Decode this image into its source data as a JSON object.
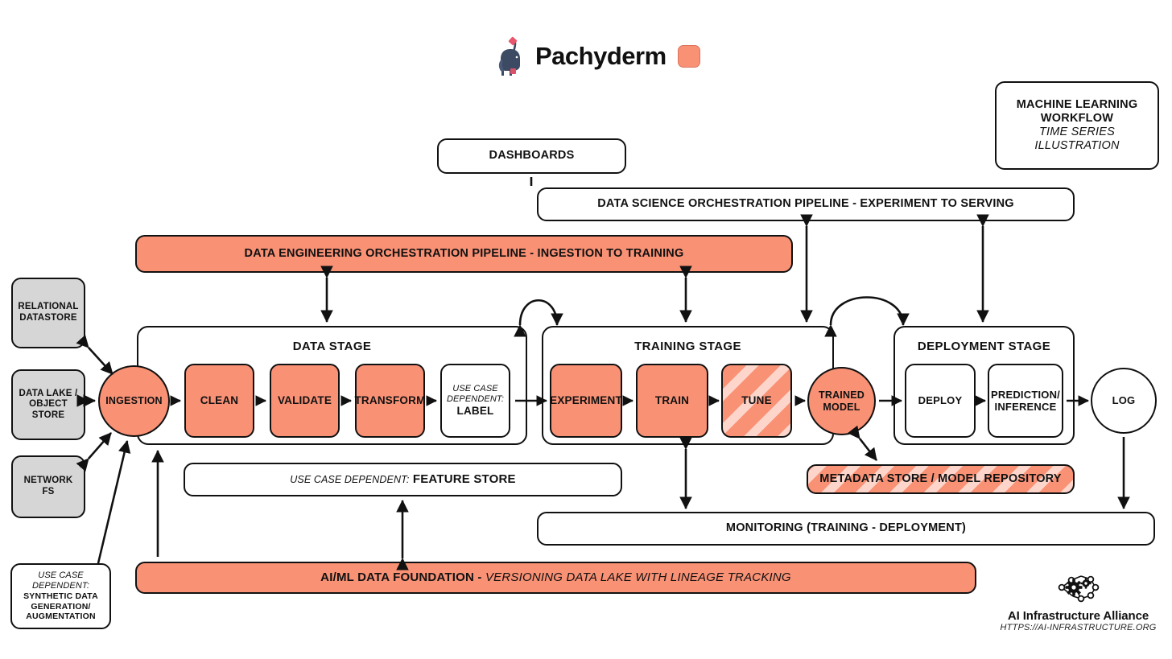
{
  "brand": {
    "name": "Pachyderm",
    "logo_icon": "elephant-icon",
    "chip_color": "#f99175"
  },
  "title_card": {
    "line1": "MACHINE LEARNING",
    "line2": "WORKFLOW",
    "line3": "TIME SERIES",
    "line4": "ILLUSTRATION"
  },
  "top": {
    "dashboards": "DASHBOARDS",
    "data_science_pipeline": "DATA SCIENCE ORCHESTRATION PIPELINE - EXPERIMENT TO SERVING",
    "data_engineering_pipeline": "DATA ENGINEERING ORCHESTRATION PIPELINE - INGESTION TO TRAINING"
  },
  "sources": [
    {
      "label": "RELATIONAL\nDATASTORE",
      "line1": "RELATIONAL",
      "line2": "DATASTORE"
    },
    {
      "label": "DATA LAKE /\nOBJECT\nSTORE",
      "line1": "DATA LAKE /",
      "line2": "OBJECT",
      "line3": "STORE"
    },
    {
      "label": "NETWORK FS",
      "line1": "NETWORK FS"
    }
  ],
  "synthetic": {
    "prefix_line1": "USE CASE",
    "prefix_line2": "DEPENDENT:",
    "line1": "SYNTHETIC DATA",
    "line2": "GENERATION/",
    "line3": "AUGMENTATION"
  },
  "ingestion": {
    "label": "INGESTION"
  },
  "stages": [
    {
      "title": "DATA STAGE",
      "nodes": [
        {
          "label": "CLEAN",
          "fill": "orange"
        },
        {
          "label": "VALIDATE",
          "fill": "orange"
        },
        {
          "label": "TRANSFORM",
          "fill": "orange"
        },
        {
          "prefix_line1": "USE CASE",
          "prefix_line2": "DEPENDENT:",
          "label": "LABEL",
          "fill": "white"
        }
      ]
    },
    {
      "title": "TRAINING STAGE",
      "nodes": [
        {
          "label": "EXPERIMENT",
          "fill": "orange"
        },
        {
          "label": "TRAIN",
          "fill": "orange"
        },
        {
          "label": "TUNE",
          "fill": "hatch"
        }
      ]
    },
    {
      "title": "DEPLOYMENT STAGE",
      "nodes": [
        {
          "label": "DEPLOY",
          "fill": "white"
        },
        {
          "line1": "PREDICTION/",
          "line2": "INFERENCE",
          "fill": "white"
        }
      ]
    }
  ],
  "trained_model": {
    "line1": "TRAINED",
    "line2": "MODEL"
  },
  "log": {
    "label": "LOG"
  },
  "feature_store": {
    "prefix": "USE CASE DEPENDENT:",
    "label": "FEATURE STORE"
  },
  "metadata_store": {
    "label": "METADATA STORE / MODEL REPOSITORY"
  },
  "monitoring": {
    "label": "MONITORING (TRAINING - DEPLOYMENT)"
  },
  "foundation": {
    "bold": "AI/ML DATA FOUNDATION -",
    "italic": "VERSIONING DATA LAKE WITH LINEAGE TRACKING"
  },
  "footer": {
    "icon": "network-gear-icon",
    "name": "AI Infrastructure Alliance",
    "url": "HTTPS://AI-INFRASTRUCTURE.ORG"
  },
  "colors": {
    "accent": "#f99175",
    "gray": "#d6d6d6",
    "stroke": "#111111"
  }
}
